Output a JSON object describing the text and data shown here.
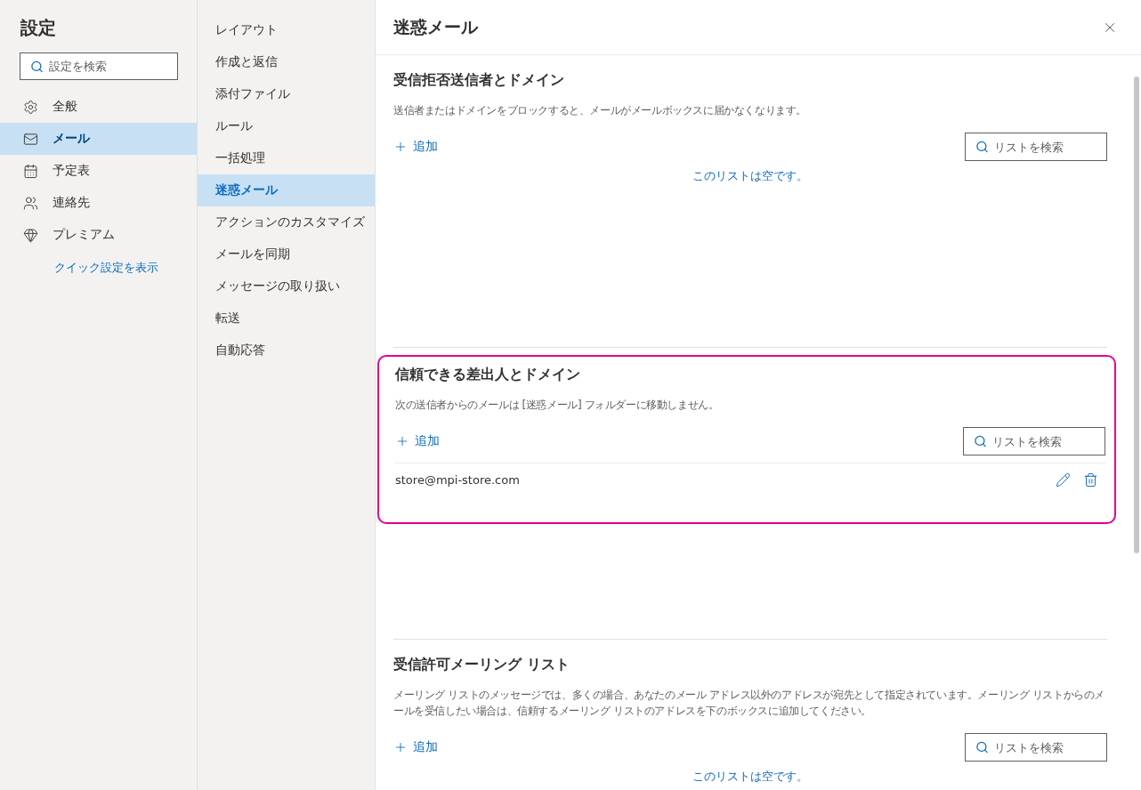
{
  "settings": {
    "title": "設定",
    "search_placeholder": "設定を検索",
    "categories": [
      {
        "label": "全般",
        "selected": false
      },
      {
        "label": "メール",
        "selected": true
      },
      {
        "label": "予定表",
        "selected": false
      },
      {
        "label": "連絡先",
        "selected": false
      },
      {
        "label": "プレミアム",
        "selected": false
      }
    ],
    "quick_settings_link": "クイック設定を表示"
  },
  "subnav": [
    {
      "label": "レイアウト",
      "selected": false
    },
    {
      "label": "作成と返信",
      "selected": false
    },
    {
      "label": "添付ファイル",
      "selected": false
    },
    {
      "label": "ルール",
      "selected": false
    },
    {
      "label": "一括処理",
      "selected": false
    },
    {
      "label": "迷惑メール",
      "selected": true
    },
    {
      "label": "アクションのカスタマイズ",
      "selected": false
    },
    {
      "label": "メールを同期",
      "selected": false
    },
    {
      "label": "メッセージの取り扱い",
      "selected": false
    },
    {
      "label": "転送",
      "selected": false
    },
    {
      "label": "自動応答",
      "selected": false
    }
  ],
  "panel": {
    "title": "迷惑メール",
    "sections": [
      {
        "title": "受信拒否送信者とドメイン",
        "description": "送信者またはドメインをブロックすると、メールがメールボックスに届かなくなります。",
        "add_label": "追加",
        "search_placeholder": "リストを検索",
        "highlighted": false,
        "empty_message": "このリストは空です。"
      },
      {
        "title": "信頼できる差出人とドメイン",
        "description": "次の送信者からのメールは [迷惑メール] フォルダーに移動しません。",
        "add_label": "追加",
        "search_placeholder": "リストを検索",
        "highlighted": true,
        "entries": [
          "store@mpi-store.com"
        ]
      },
      {
        "title": "受信許可メーリング リスト",
        "description": "メーリング リストのメッセージでは、多くの場合、あなたのメール アドレス以外のアドレスが宛先として指定されています。メーリング リストからのメールを受信したい場合は、信頼するメーリング リストのアドレスを下のボックスに追加してください。",
        "add_label": "追加",
        "search_placeholder": "リストを検索",
        "highlighted": false,
        "empty_message": "このリストは空です。"
      }
    ]
  }
}
